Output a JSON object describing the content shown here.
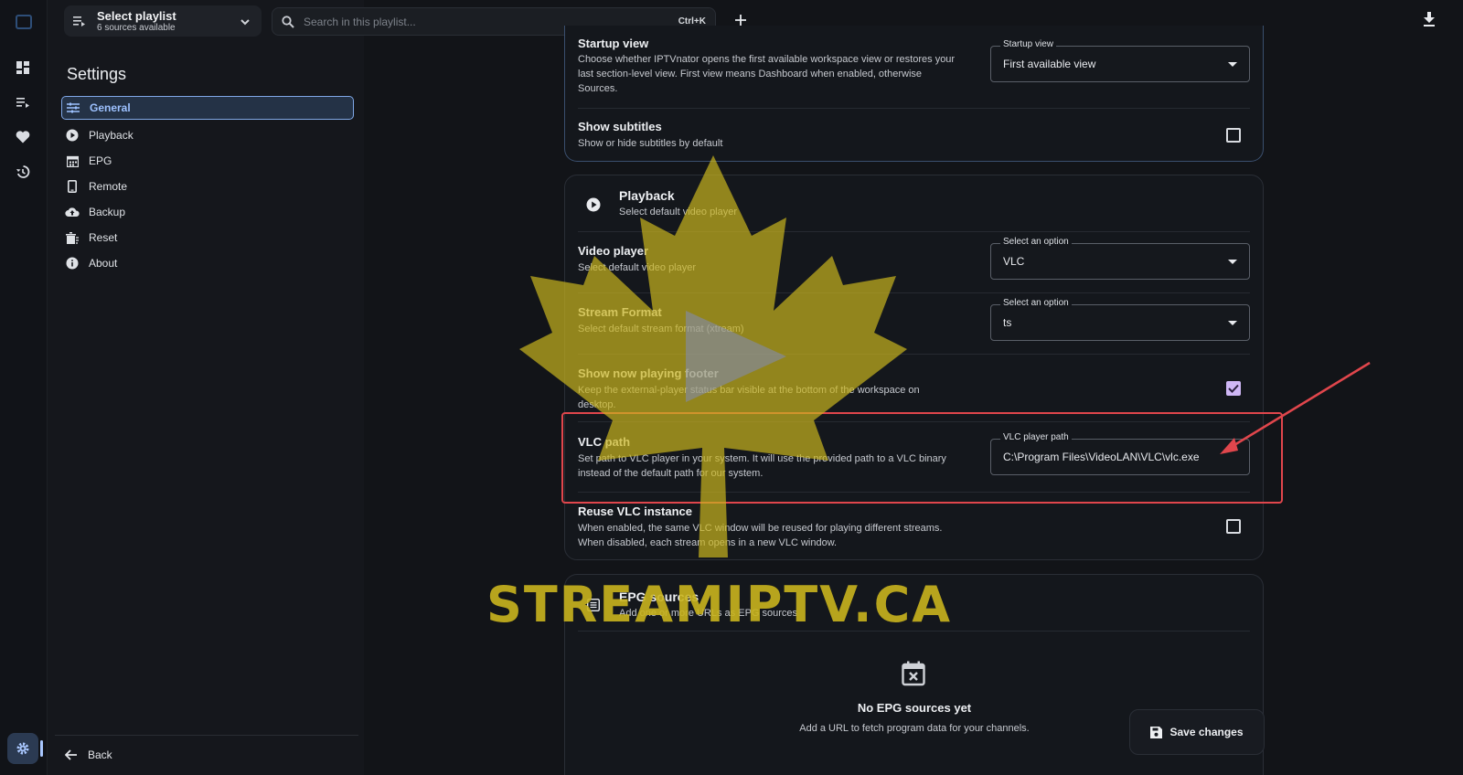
{
  "topbar": {
    "playlist_title": "Select playlist",
    "playlist_sub": "6 sources available",
    "search_placeholder": "Search in this playlist...",
    "search_shortcut": "Ctrl+K"
  },
  "sidebar": {
    "title": "Settings",
    "items": [
      {
        "label": "General",
        "icon": "tune-icon",
        "active": true
      },
      {
        "label": "Playback",
        "icon": "play-circle-icon"
      },
      {
        "label": "EPG",
        "icon": "calendar-icon"
      },
      {
        "label": "Remote",
        "icon": "phone-icon"
      },
      {
        "label": "Backup",
        "icon": "cloud-upload-icon"
      },
      {
        "label": "Reset",
        "icon": "reset-icon"
      },
      {
        "label": "About",
        "icon": "info-icon"
      }
    ],
    "back_label": "Back"
  },
  "general": {
    "startup_title": "Startup view",
    "startup_desc_1": "Choose whether IPTVnator opens the first available workspace view or restores your",
    "startup_desc_2": "last section-level view. First view means Dashboard when enabled, otherwise",
    "startup_desc_3": "Sources.",
    "startup_field_label": "Startup view",
    "startup_field_value": "First available view",
    "subtitles_title": "Show subtitles",
    "subtitles_desc": "Show or hide subtitles by default",
    "subtitles_checked": false
  },
  "playback": {
    "title": "Playback",
    "subtitle": "Select default video player",
    "video_player_title": "Video player",
    "video_player_desc": "Select default video player",
    "video_player_label": "Select an option",
    "video_player_value": "VLC",
    "stream_format_title": "Stream Format",
    "stream_format_desc": "Select default stream format (xtream)",
    "stream_format_label": "Select an option",
    "stream_format_value": "ts",
    "footer_title": "Show now playing footer",
    "footer_desc_1": "Keep the external-player status bar visible at the bottom of the workspace on",
    "footer_desc_2": "desktop.",
    "footer_checked": true,
    "vlc_path_title": "VLC path",
    "vlc_path_desc_1": "Set path to VLC player in your system. It will use the provided path to a VLC binary",
    "vlc_path_desc_2": "instead of the default path for our system.",
    "vlc_path_label": "VLC player path",
    "vlc_path_value": "C:\\Program Files\\VideoLAN\\VLC\\vlc.exe",
    "reuse_title": "Reuse VLC instance",
    "reuse_desc_1": "When enabled, the same VLC window will be reused for playing different streams.",
    "reuse_desc_2": "When disabled, each stream opens in a new VLC window.",
    "reuse_checked": false
  },
  "epg": {
    "title": "EPG sources",
    "subtitle": "Add one or more URLs as EPG sources",
    "empty_title": "No EPG sources yet",
    "empty_sub": "Add a URL to fetch program data for your channels."
  },
  "actions": {
    "save_label": "Save changes"
  },
  "watermark": {
    "text": "STREAMIPTV.CA"
  },
  "colors": {
    "accent": "#9dc1ff",
    "highlight": "#e0464c",
    "checkbox_checked": "#cfb7f5",
    "watermark": "#c9b41e"
  }
}
